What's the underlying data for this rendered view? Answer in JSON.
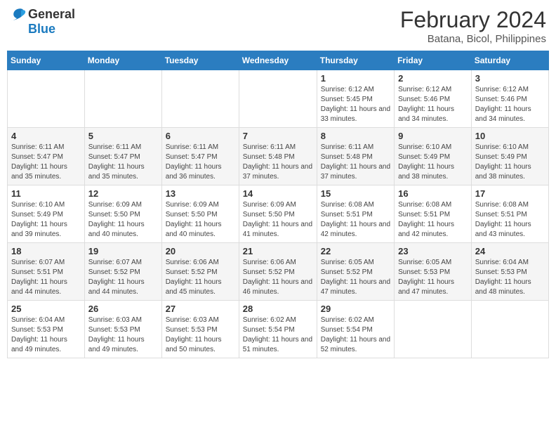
{
  "header": {
    "logo_line1": "General",
    "logo_line2": "Blue",
    "title": "February 2024",
    "subtitle": "Batana, Bicol, Philippines"
  },
  "calendar": {
    "days_of_week": [
      "Sunday",
      "Monday",
      "Tuesday",
      "Wednesday",
      "Thursday",
      "Friday",
      "Saturday"
    ],
    "weeks": [
      [
        {
          "day": "",
          "info": ""
        },
        {
          "day": "",
          "info": ""
        },
        {
          "day": "",
          "info": ""
        },
        {
          "day": "",
          "info": ""
        },
        {
          "day": "1",
          "info": "Sunrise: 6:12 AM\nSunset: 5:45 PM\nDaylight: 11 hours and 33 minutes."
        },
        {
          "day": "2",
          "info": "Sunrise: 6:12 AM\nSunset: 5:46 PM\nDaylight: 11 hours and 34 minutes."
        },
        {
          "day": "3",
          "info": "Sunrise: 6:12 AM\nSunset: 5:46 PM\nDaylight: 11 hours and 34 minutes."
        }
      ],
      [
        {
          "day": "4",
          "info": "Sunrise: 6:11 AM\nSunset: 5:47 PM\nDaylight: 11 hours and 35 minutes."
        },
        {
          "day": "5",
          "info": "Sunrise: 6:11 AM\nSunset: 5:47 PM\nDaylight: 11 hours and 35 minutes."
        },
        {
          "day": "6",
          "info": "Sunrise: 6:11 AM\nSunset: 5:47 PM\nDaylight: 11 hours and 36 minutes."
        },
        {
          "day": "7",
          "info": "Sunrise: 6:11 AM\nSunset: 5:48 PM\nDaylight: 11 hours and 37 minutes."
        },
        {
          "day": "8",
          "info": "Sunrise: 6:11 AM\nSunset: 5:48 PM\nDaylight: 11 hours and 37 minutes."
        },
        {
          "day": "9",
          "info": "Sunrise: 6:10 AM\nSunset: 5:49 PM\nDaylight: 11 hours and 38 minutes."
        },
        {
          "day": "10",
          "info": "Sunrise: 6:10 AM\nSunset: 5:49 PM\nDaylight: 11 hours and 38 minutes."
        }
      ],
      [
        {
          "day": "11",
          "info": "Sunrise: 6:10 AM\nSunset: 5:49 PM\nDaylight: 11 hours and 39 minutes."
        },
        {
          "day": "12",
          "info": "Sunrise: 6:09 AM\nSunset: 5:50 PM\nDaylight: 11 hours and 40 minutes."
        },
        {
          "day": "13",
          "info": "Sunrise: 6:09 AM\nSunset: 5:50 PM\nDaylight: 11 hours and 40 minutes."
        },
        {
          "day": "14",
          "info": "Sunrise: 6:09 AM\nSunset: 5:50 PM\nDaylight: 11 hours and 41 minutes."
        },
        {
          "day": "15",
          "info": "Sunrise: 6:08 AM\nSunset: 5:51 PM\nDaylight: 11 hours and 42 minutes."
        },
        {
          "day": "16",
          "info": "Sunrise: 6:08 AM\nSunset: 5:51 PM\nDaylight: 11 hours and 42 minutes."
        },
        {
          "day": "17",
          "info": "Sunrise: 6:08 AM\nSunset: 5:51 PM\nDaylight: 11 hours and 43 minutes."
        }
      ],
      [
        {
          "day": "18",
          "info": "Sunrise: 6:07 AM\nSunset: 5:51 PM\nDaylight: 11 hours and 44 minutes."
        },
        {
          "day": "19",
          "info": "Sunrise: 6:07 AM\nSunset: 5:52 PM\nDaylight: 11 hours and 44 minutes."
        },
        {
          "day": "20",
          "info": "Sunrise: 6:06 AM\nSunset: 5:52 PM\nDaylight: 11 hours and 45 minutes."
        },
        {
          "day": "21",
          "info": "Sunrise: 6:06 AM\nSunset: 5:52 PM\nDaylight: 11 hours and 46 minutes."
        },
        {
          "day": "22",
          "info": "Sunrise: 6:05 AM\nSunset: 5:52 PM\nDaylight: 11 hours and 47 minutes."
        },
        {
          "day": "23",
          "info": "Sunrise: 6:05 AM\nSunset: 5:53 PM\nDaylight: 11 hours and 47 minutes."
        },
        {
          "day": "24",
          "info": "Sunrise: 6:04 AM\nSunset: 5:53 PM\nDaylight: 11 hours and 48 minutes."
        }
      ],
      [
        {
          "day": "25",
          "info": "Sunrise: 6:04 AM\nSunset: 5:53 PM\nDaylight: 11 hours and 49 minutes."
        },
        {
          "day": "26",
          "info": "Sunrise: 6:03 AM\nSunset: 5:53 PM\nDaylight: 11 hours and 49 minutes."
        },
        {
          "day": "27",
          "info": "Sunrise: 6:03 AM\nSunset: 5:53 PM\nDaylight: 11 hours and 50 minutes."
        },
        {
          "day": "28",
          "info": "Sunrise: 6:02 AM\nSunset: 5:54 PM\nDaylight: 11 hours and 51 minutes."
        },
        {
          "day": "29",
          "info": "Sunrise: 6:02 AM\nSunset: 5:54 PM\nDaylight: 11 hours and 52 minutes."
        },
        {
          "day": "",
          "info": ""
        },
        {
          "day": "",
          "info": ""
        }
      ]
    ]
  }
}
